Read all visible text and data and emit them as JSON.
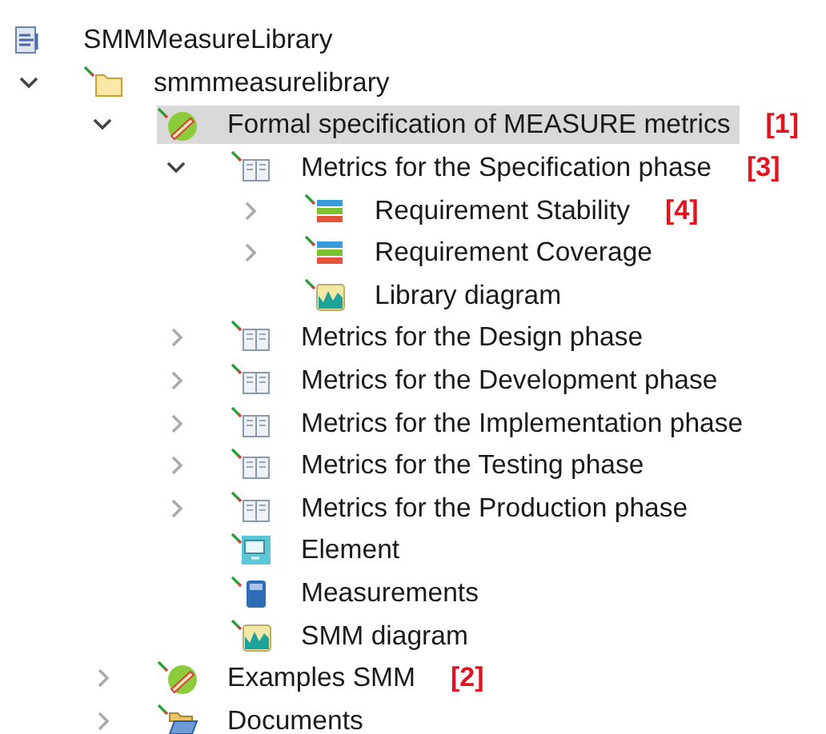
{
  "tree": {
    "label": "SMMMeasureLibrary",
    "kind": "model",
    "children": [
      {
        "label": "smmmeasurelibrary",
        "kind": "folder",
        "expanded": true,
        "selected": false,
        "children": [
          {
            "label": "Formal specification of MEASURE metrics",
            "kind": "library",
            "expanded": true,
            "selected": true,
            "annotation": "[1]",
            "children": [
              {
                "label": "Metrics for the Specification phase",
                "kind": "book",
                "expanded": true,
                "selected": false,
                "annotation": "[3]",
                "children": [
                  {
                    "label": "Requirement Stability",
                    "kind": "stack",
                    "expanded": false,
                    "selected": false,
                    "annotation": "[4]"
                  },
                  {
                    "label": "Requirement Coverage",
                    "kind": "stack",
                    "expanded": false,
                    "selected": false
                  },
                  {
                    "label": "Library diagram",
                    "kind": "diagram",
                    "selected": false
                  }
                ]
              },
              {
                "label": "Metrics for the Design phase",
                "kind": "book",
                "expanded": false,
                "selected": false
              },
              {
                "label": "Metrics for the Development phase",
                "kind": "book",
                "expanded": false,
                "selected": false
              },
              {
                "label": "Metrics for the Implementation phase",
                "kind": "book",
                "expanded": false,
                "selected": false
              },
              {
                "label": "Metrics for the Testing phase",
                "kind": "book",
                "expanded": false,
                "selected": false
              },
              {
                "label": "Metrics for the Production phase",
                "kind": "book",
                "expanded": false,
                "selected": false
              },
              {
                "label": "Element",
                "kind": "element",
                "selected": false
              },
              {
                "label": "Measurements",
                "kind": "measurement",
                "selected": false
              },
              {
                "label": "SMM diagram",
                "kind": "diagram",
                "selected": false
              }
            ]
          },
          {
            "label": "Examples SMM",
            "kind": "library",
            "expanded": false,
            "selected": false,
            "annotation": "[2]"
          },
          {
            "label": "Documents",
            "kind": "open-folder",
            "expanded": false,
            "selected": false
          }
        ]
      }
    ]
  }
}
